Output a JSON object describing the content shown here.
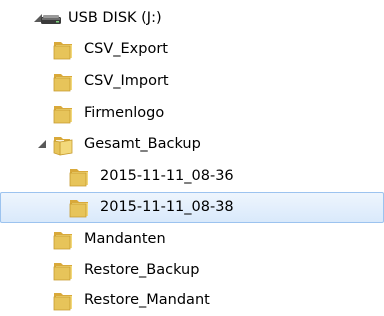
{
  "tree": {
    "drive": {
      "label": "USB DISK (J:)",
      "icon": "usb-drive-icon",
      "expanded": true
    },
    "folders": [
      {
        "label": "CSV_Export",
        "icon": "folder-icon"
      },
      {
        "label": "CSV_Import",
        "icon": "folder-icon"
      },
      {
        "label": "Firmenlogo",
        "icon": "folder-icon"
      },
      {
        "label": "Gesamt_Backup",
        "icon": "folder-open-icon",
        "expanded": true,
        "children": [
          {
            "label": "2015-11-11_08-36",
            "icon": "folder-icon"
          },
          {
            "label": "2015-11-11_08-38",
            "icon": "folder-icon",
            "selected": true
          }
        ]
      },
      {
        "label": "Mandanten",
        "icon": "folder-icon"
      },
      {
        "label": "Restore_Backup",
        "icon": "folder-icon"
      },
      {
        "label": "Restore_Mandant",
        "icon": "folder-icon"
      }
    ]
  },
  "colors": {
    "folder_body": "#e7c45a",
    "folder_tab": "#f3d97b",
    "selection_fill": "#d9e9fb",
    "selection_border": "#9cc3ef",
    "expander": "#595959"
  }
}
